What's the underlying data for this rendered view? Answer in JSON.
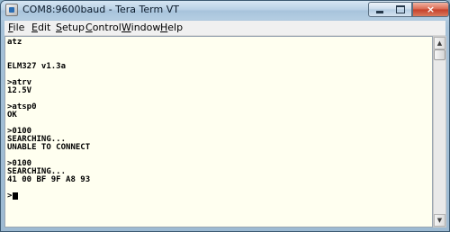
{
  "window": {
    "title": "COM8:9600baud - Tera Term VT",
    "controls": {
      "minimize": "minimize",
      "maximize": "maximize",
      "close": "×"
    }
  },
  "menu": [
    {
      "mnemonic": "F",
      "rest": "ile"
    },
    {
      "mnemonic": "E",
      "rest": "dit"
    },
    {
      "mnemonic": "S",
      "rest": "etup"
    },
    {
      "mnemonic": "C",
      "rest": "ontrol"
    },
    {
      "mnemonic": "W",
      "rest": "indow"
    },
    {
      "mnemonic": "H",
      "rest": "elp"
    }
  ],
  "terminal": {
    "lines": [
      "atz",
      "",
      "",
      "ELM327 v1.3a",
      "",
      ">atrv",
      "12.5V",
      "",
      ">atsp0",
      "OK",
      "",
      ">0100",
      "SEARCHING...",
      "UNABLE TO CONNECT",
      "",
      ">0100",
      "SEARCHING...",
      "41 00 BF 9F A8 93",
      "",
      ">"
    ]
  },
  "icons": {
    "app": "tera-term-app-icon",
    "scroll_up": "scroll-up-arrow-icon",
    "scroll_down": "scroll-down-arrow-icon"
  }
}
